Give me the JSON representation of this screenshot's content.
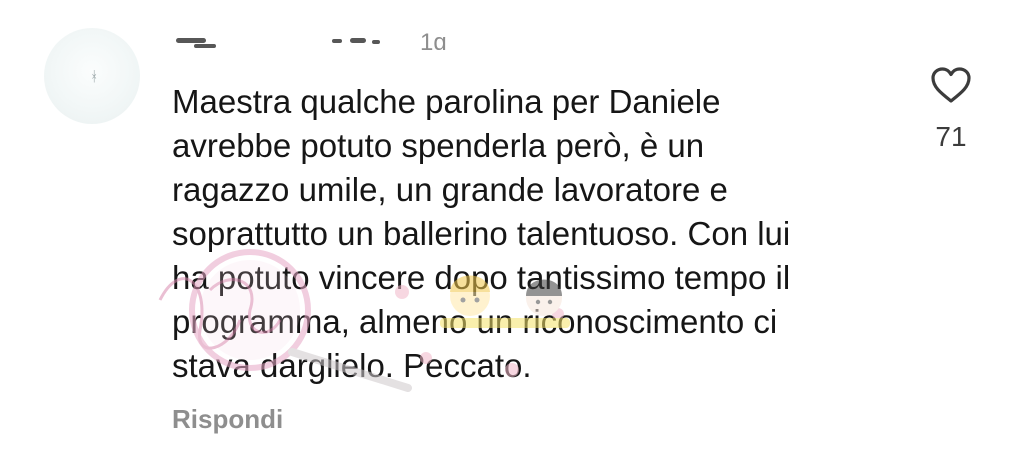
{
  "comment": {
    "timestamp": "1g",
    "lines": [
      "Maestra qualche parolina per Daniele",
      "avrebbe potuto spenderla però, è un",
      "ragazzo umile, un grande lavoratore e",
      "soprattutto un ballerino talentuoso. Con lui",
      "ha potuto vincere dopo tantissimo tempo il",
      "programma, almeno un riconoscimento ci",
      "stava darglielo. Peccato."
    ],
    "reply_label": "Rispondi"
  },
  "like": {
    "icon": "heart-outline-icon",
    "count": "71"
  },
  "colors": {
    "text": "#161616",
    "secondary": "#8e8e8e",
    "watermark": "#d98bb0"
  }
}
